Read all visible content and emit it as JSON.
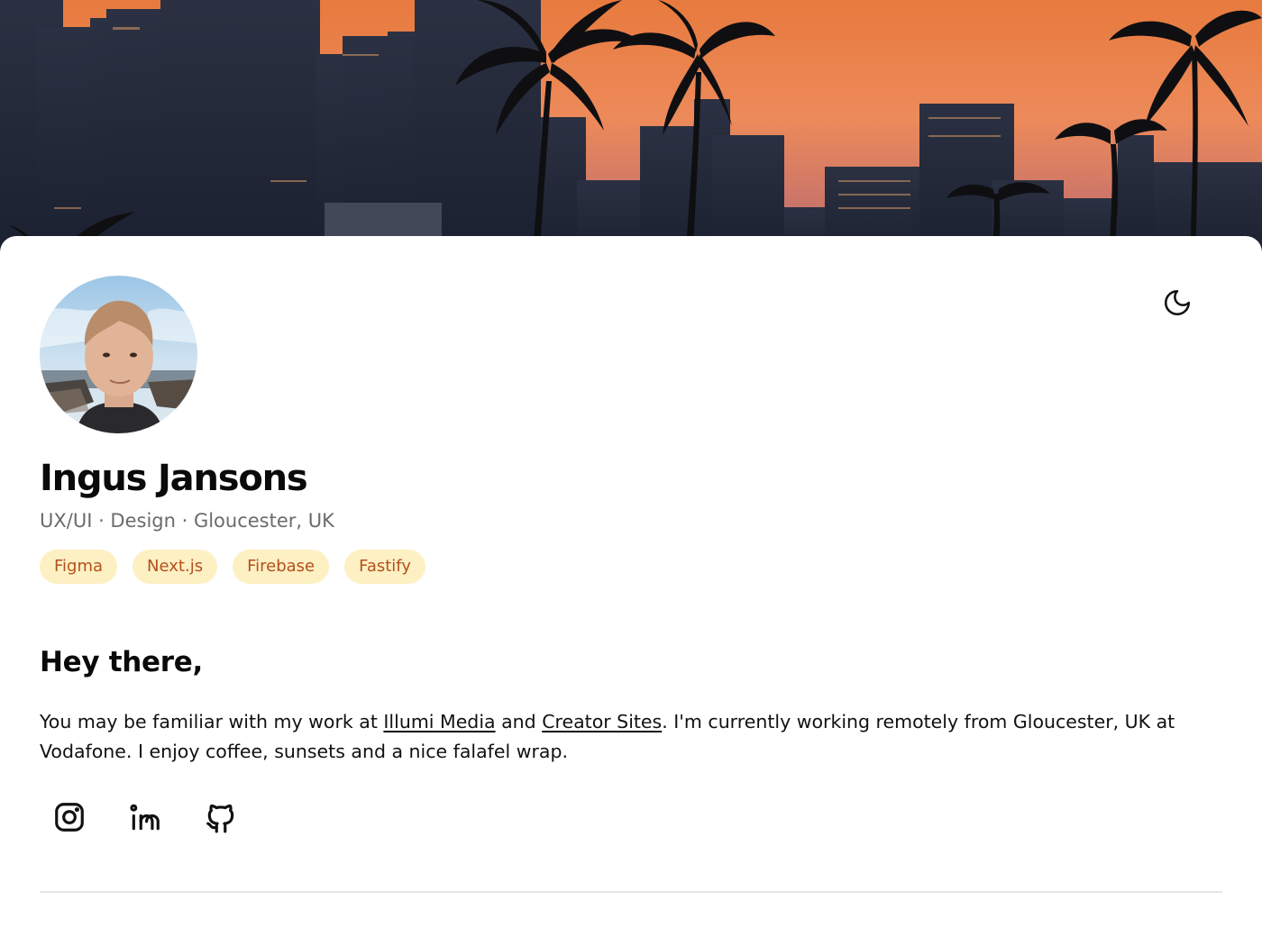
{
  "hero": {
    "image": "city-skyline-sunset-with-palm-trees"
  },
  "header": {
    "theme_toggle_icon": "moon-icon"
  },
  "profile": {
    "avatar": "profile-photo",
    "name": "Ingus Jansons",
    "subtitle": "UX/UI · Design · Gloucester, UK",
    "tags": [
      "Figma",
      "Next.js",
      "Firebase",
      "Fastify"
    ]
  },
  "about": {
    "heading": "Hey there,",
    "bio_before": "You may be familiar with my work at ",
    "link1": "Illumi Media",
    "bio_mid": " and ",
    "link2": "Creator Sites",
    "bio_after": ". I'm currently working remotely from Gloucester, UK at Vodafone. I enjoy coffee, sunsets and a nice falafel wrap."
  },
  "socials": [
    {
      "name": "Instagram",
      "icon": "instagram-icon"
    },
    {
      "name": "LinkedIn",
      "icon": "linkedin-icon"
    },
    {
      "name": "GitHub",
      "icon": "github-icon"
    }
  ],
  "colors": {
    "tag_bg": "#fdf0c3",
    "tag_text": "#b4511d",
    "text": "#0a0a0a",
    "muted": "#6b6b6b"
  }
}
